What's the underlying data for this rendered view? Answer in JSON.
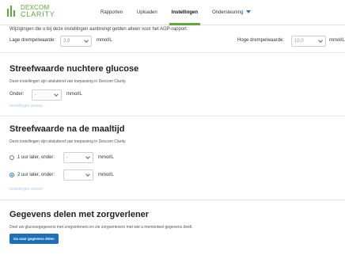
{
  "brand": {
    "name": "DEXCOM",
    "product": "CLARITY",
    "color": "#5fa83a"
  },
  "nav": {
    "items": [
      "Rapporten",
      "Uploaden",
      "Instellingen",
      "Ondersteuning"
    ],
    "active": "Instellingen"
  },
  "intro": "Wijzigingen die u bij deze instellingen aanbrengt gelden alleen voor het AGP-rapport.",
  "thresholds": {
    "low_label": "Lage drempelwaarde:",
    "low_value": "3,9",
    "high_label": "Hoge drempelwaarde:",
    "high_value": "10,0",
    "unit": "mmol/L"
  },
  "fasting": {
    "title": "Streefwaarde nuchtere glucose",
    "desc": "Deze instellingen zijn uitsluitend van toepassing in Dexcom Clarity.",
    "below_label": "Onder:",
    "below_value": "-",
    "unit": "mmol/L",
    "clear_link": "Instellingen wissen"
  },
  "postmeal": {
    "title": "Streefwaarde na de maaltijd",
    "desc": "Deze instellingen zijn uitsluitend van toepassing in Dexcom Clarity.",
    "option1_label": "1 uur later, onder:",
    "option1_value": "-",
    "option2_label": "2 uur later, onder:",
    "option2_value": "-",
    "unit": "mmol/L",
    "clear_link": "Instellingen wissen"
  },
  "share": {
    "title": "Gegevens delen met zorgverlener",
    "desc": "Deel uw glucosegegevens met zorgverleners en zie zorgverleners met wie u momenteel gegevens deelt.",
    "button": "Ga naar gegevens delen"
  }
}
